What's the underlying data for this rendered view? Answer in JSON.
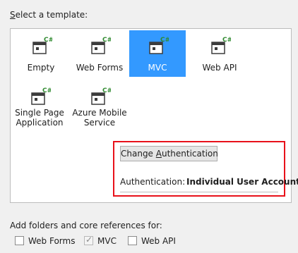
{
  "header": {
    "select_template_label": "Select a template:"
  },
  "templates": [
    {
      "label": "Empty",
      "selected": false
    },
    {
      "label": "Web Forms",
      "selected": false
    },
    {
      "label": "MVC",
      "selected": true
    },
    {
      "label": "Web API",
      "selected": false
    },
    {
      "label": "Single Page Application",
      "line1": "Single Page",
      "line2": "Application",
      "selected": false
    },
    {
      "label": "Azure Mobile Service",
      "line1": "Azure Mobile",
      "line2": "Service",
      "selected": false
    }
  ],
  "template_icon": {
    "name": "csharp-project-icon",
    "badge": "C#"
  },
  "authentication": {
    "change_button_label": "Change Authentication",
    "label": "Authentication:",
    "value": "Individual User Accounts"
  },
  "folders": {
    "label": "Add folders and core references for:",
    "options": [
      {
        "label": "Web Forms",
        "checked": false
      },
      {
        "label": "MVC",
        "checked": true,
        "disabled": true
      },
      {
        "label": "Web API",
        "checked": false
      }
    ]
  },
  "colors": {
    "selection": "#3399ff",
    "highlight_border": "#e8111a"
  }
}
